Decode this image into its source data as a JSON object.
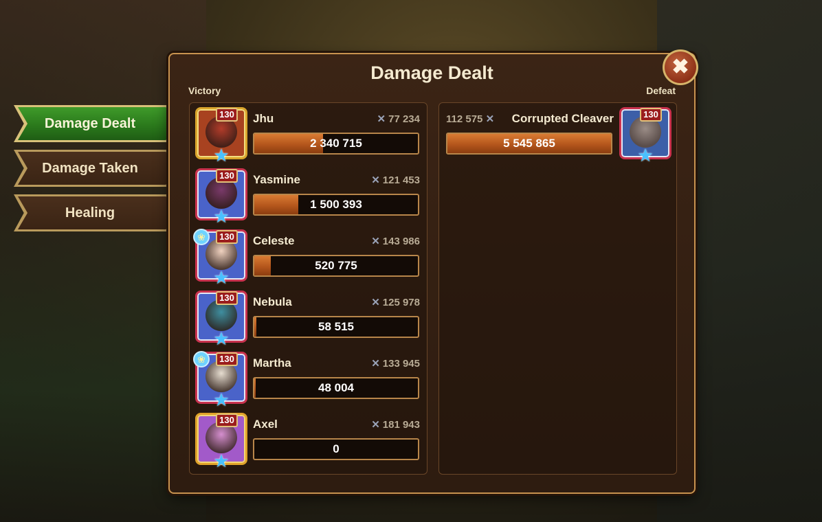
{
  "tabs": [
    {
      "label": "Damage Dealt",
      "active": true
    },
    {
      "label": "Damage Taken",
      "active": false
    },
    {
      "label": "Healing",
      "active": false
    }
  ],
  "panel": {
    "title": "Damage Dealt",
    "close_icon": "close-icon",
    "close_glyph": "✖",
    "victory_label": "Victory",
    "defeat_label": "Defeat"
  },
  "team": [
    {
      "name": "Jhu",
      "level": "130",
      "power": "77 234",
      "damage": "2 340 715",
      "fill_fraction": 0.42,
      "pet": false,
      "frame": "gold"
    },
    {
      "name": "Yasmine",
      "level": "130",
      "power": "121 453",
      "damage": "1 500 393",
      "fill_fraction": 0.27,
      "pet": false,
      "frame": "red"
    },
    {
      "name": "Celeste",
      "level": "130",
      "power": "143 986",
      "damage": "520 775",
      "fill_fraction": 0.1,
      "pet": true,
      "frame": "red"
    },
    {
      "name": "Nebula",
      "level": "130",
      "power": "125 978",
      "damage": "58 515",
      "fill_fraction": 0.012,
      "pet": false,
      "frame": "red"
    },
    {
      "name": "Martha",
      "level": "130",
      "power": "133 945",
      "damage": "48 004",
      "fill_fraction": 0.01,
      "pet": true,
      "frame": "red"
    },
    {
      "name": "Axel",
      "level": "130",
      "power": "181 943",
      "damage": "0",
      "fill_fraction": 0,
      "pet": false,
      "frame": "pink"
    }
  ],
  "enemy": {
    "name": "Corrupted Cleaver",
    "level": "130",
    "power": "112 575",
    "damage": "5 545 865",
    "fill_fraction": 1.0
  },
  "icons": {
    "power": "crossed-swords-icon",
    "star": "star-icon",
    "pet": "pet-paw-icon"
  },
  "colors": {
    "accent_orange": "#b4561c",
    "active_tab": "#2b7a1c",
    "level_badge": "#9b1d1d"
  }
}
